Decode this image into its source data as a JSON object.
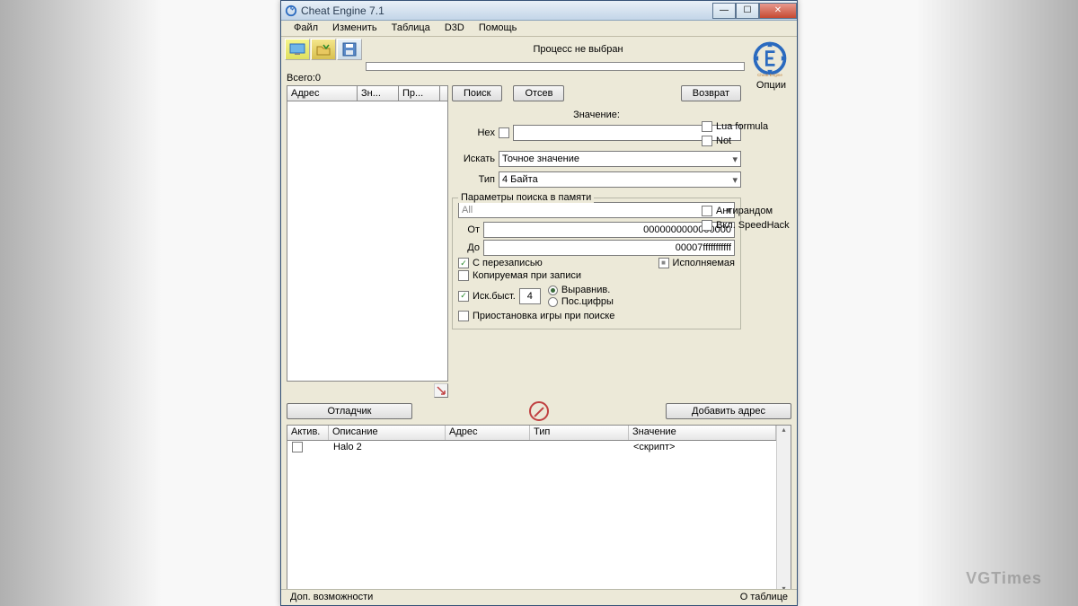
{
  "window": {
    "title": "Cheat Engine 7.1"
  },
  "menu": {
    "file": "Файл",
    "edit": "Изменить",
    "table": "Таблица",
    "d3d": "D3D",
    "help": "Помощь"
  },
  "toolbar": {
    "process_msg": "Процесс не выбран"
  },
  "total": {
    "label": "Всего:",
    "value": "0"
  },
  "results": {
    "col_addr": "Адрес",
    "col_val": "Зн...",
    "col_prev": "Пр..."
  },
  "actions": {
    "search": "Поиск",
    "filter": "Отсев",
    "undo": "Возврат",
    "debugger": "Отладчик",
    "add_addr": "Добавить адрес",
    "options": "Опции"
  },
  "scan": {
    "value_label": "Значение:",
    "hex_label": "Hex",
    "search_label": "Искать",
    "search_value": "Точное значение",
    "type_label": "Тип",
    "type_value": "4 Байта",
    "lua_formula": "Lua formula",
    "not": "Not"
  },
  "memory": {
    "title": "Параметры поиска в памяти",
    "region": "All",
    "from_label": "От",
    "from_value": "0000000000000000",
    "to_label": "До",
    "to_value": "00007fffffffffff",
    "overwrite": "С перезаписью",
    "executable": "Исполняемая",
    "cow": "Копируемая при записи",
    "anti_random": "Антирандом",
    "speedhack": "Вкл. SpeedHack"
  },
  "fastscan": {
    "label": "Иск.быст.",
    "value": "4",
    "align": "Выравнив.",
    "lastdigits": "Пос.цифры"
  },
  "pause": {
    "label": "Приостановка игры при поиске"
  },
  "addr_table": {
    "col_active": "Актив.",
    "col_desc": "Описание",
    "col_addr": "Адрес",
    "col_type": "Тип",
    "col_value": "Значение",
    "rows": [
      {
        "desc": "Halo 2",
        "value": "<скрипт>"
      }
    ]
  },
  "status": {
    "left": "Доп. возможности",
    "right": "О таблице"
  },
  "watermark": "VGTimes"
}
